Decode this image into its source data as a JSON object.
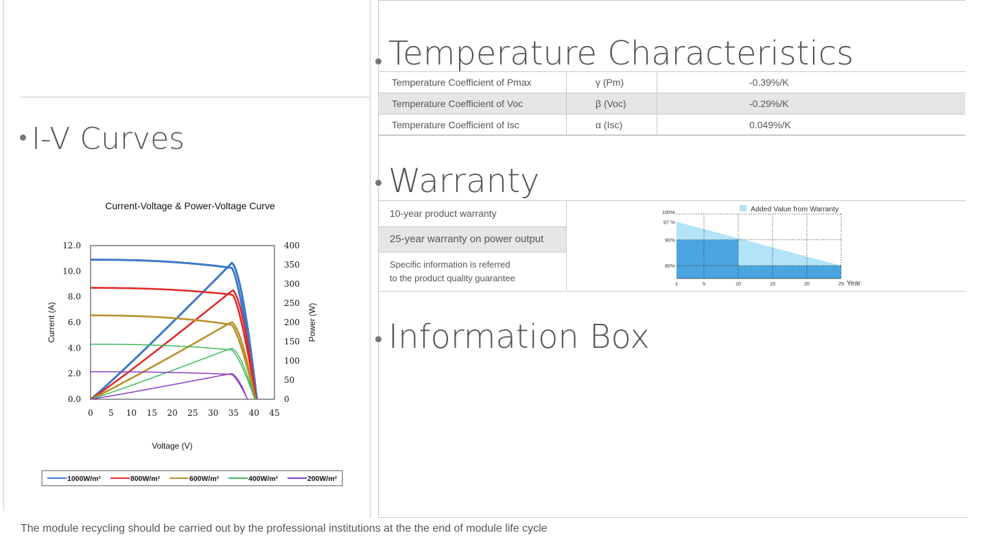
{
  "sections": {
    "iv_title": "I-V Curves",
    "temp_title": "Temperature Characteristics",
    "warranty_title": "Warranty",
    "info_title": "Information Box"
  },
  "temperature_table": [
    {
      "label": "Temperature Coefficient of Pmax",
      "symbol": "γ (Pm)",
      "value": "-0.39%/K"
    },
    {
      "label": "Temperature Coefficient of Voc",
      "symbol": "β (Voc)",
      "value": "-0.29%/K"
    },
    {
      "label": "Temperature Coefficient of Isc",
      "symbol": "α (Isc)",
      "value": "0.049%/K"
    }
  ],
  "warranty": {
    "items": [
      "10-year product warranty",
      "25-year warranty on power output"
    ],
    "note_line1": "Specific information is referred",
    "note_line2": "to the product quality guarantee",
    "legend": "Added Value from Warranty",
    "colors": {
      "light": "#b3e3f7",
      "dark": "#4aa5e0"
    }
  },
  "footer": "The module recycling should be carried out by the professional institutions at the the end of module life cycle",
  "chart_data": [
    {
      "type": "line",
      "title": "Current-Voltage & Power-Voltage Curve",
      "xlabel": "Voltage (V)",
      "ylabel": "Current (A)",
      "y2label": "Power (W)",
      "xlim": [
        0,
        45
      ],
      "ylim": [
        0,
        12
      ],
      "y2lim": [
        0,
        400
      ],
      "xticks": [
        "0",
        "5",
        "10",
        "15",
        "20",
        "25",
        "30",
        "35",
        "40",
        "45"
      ],
      "yticks": [
        "0.0",
        "2.0",
        "4.0",
        "6.0",
        "8.0",
        "10.0",
        "12.0"
      ],
      "y2ticks": [
        "0",
        "50",
        "100",
        "150",
        "200",
        "250",
        "300",
        "350",
        "400"
      ],
      "legend_position": "bottom",
      "series": [
        {
          "name": "1000W/m²",
          "color": "#3a78c8",
          "isc": 10.9,
          "voc": 40.7,
          "vmp": 34.6,
          "pmax": 355,
          "width": 3
        },
        {
          "name": "800W/m²",
          "color": "#e02a2a",
          "isc": 8.7,
          "voc": 40.5,
          "vmp": 34.8,
          "pmax": 284,
          "width": 2.6
        },
        {
          "name": "600W/m²",
          "color": "#b8902a",
          "isc": 6.55,
          "voc": 40.3,
          "vmp": 34.5,
          "pmax": 201,
          "width": 2.6
        },
        {
          "name": "400W/m²",
          "color": "#3cba5a",
          "isc": 4.3,
          "voc": 40.2,
          "vmp": 34.5,
          "pmax": 133,
          "width": 1.5
        },
        {
          "name": "200W/m²",
          "color": "#8a3cc0",
          "isc": 2.15,
          "voc": 38.4,
          "vmp": 34.5,
          "pmax": 67,
          "width": 1.5
        }
      ]
    },
    {
      "type": "area",
      "title": "",
      "xlabel": "Year",
      "ylabel": "",
      "xlim": [
        1,
        25
      ],
      "ylim": [
        75,
        100
      ],
      "xticks": [
        "1",
        "5",
        "10",
        "15",
        "20",
        "25"
      ],
      "yticks": [
        "100%",
        "97 %",
        "90%",
        "80%"
      ],
      "legend_position": "top-right",
      "series": [
        {
          "name": "Added Value from Warranty",
          "x": [
            1,
            25
          ],
          "values": [
            97,
            80
          ]
        },
        {
          "name": "",
          "x": [
            1,
            10,
            10,
            25
          ],
          "values": [
            90,
            90,
            80,
            80
          ]
        }
      ]
    }
  ]
}
